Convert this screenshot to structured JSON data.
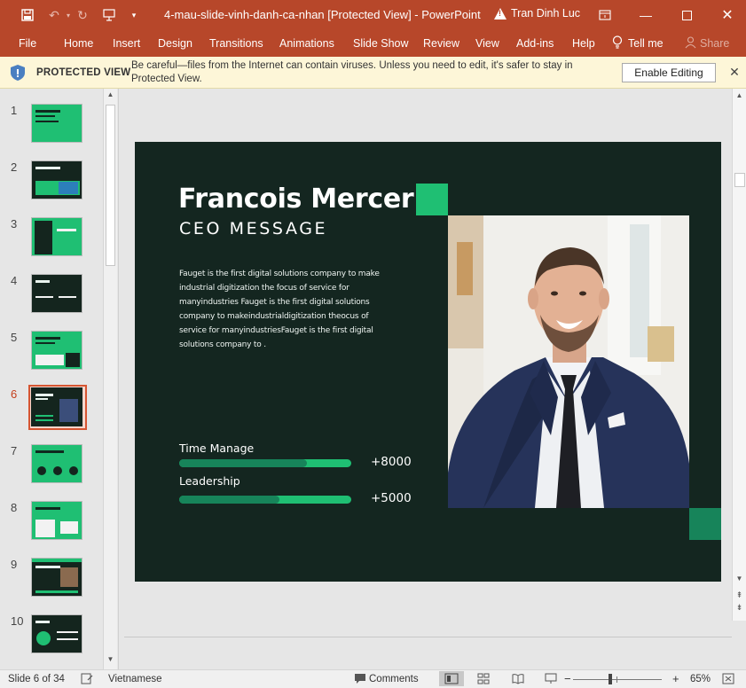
{
  "titlebar": {
    "document_title": "4-mau-slide-vinh-danh-ca-nhan [Protected View]  -  PowerPoint",
    "user_name": "Tran Dinh Luc"
  },
  "ribbon": {
    "tabs": [
      "File",
      "Home",
      "Insert",
      "Design",
      "Transitions",
      "Animations",
      "Slide Show",
      "Review",
      "View",
      "Add-ins",
      "Help",
      "Tell me",
      "Share"
    ]
  },
  "protected_view": {
    "label": "PROTECTED VIEW",
    "message": "Be careful—files from the Internet can contain viruses. Unless you need to edit, it's safer to stay in Protected View.",
    "enable_button": "Enable Editing"
  },
  "thumbnails": {
    "numbers": [
      "1",
      "2",
      "3",
      "4",
      "5",
      "6",
      "7",
      "8",
      "9",
      "10"
    ],
    "selected": 6
  },
  "slide": {
    "title": "Francois Mercer",
    "subtitle": "CEO MESSAGE",
    "body": "Fauget is the first digital solutions company to make industrial digitization the focus of service for manyindustries Fauget is the first digital solutions company to makeindustrialdigitization theocus of service for manyindustriesFauget is the first digital solutions company to .",
    "skills": [
      {
        "label": "Time Manage",
        "value": "+8000",
        "level": 0.74
      },
      {
        "label": "Leadership",
        "value": "+5000",
        "level": 0.58
      }
    ],
    "colors": {
      "background": "#142620",
      "accent": "#1fbf73",
      "accent_dark": "#17845a"
    }
  },
  "statusbar": {
    "slide_counter": "Slide 6 of 34",
    "language": "Vietnamese",
    "comments": "Comments",
    "zoom": "65%"
  }
}
